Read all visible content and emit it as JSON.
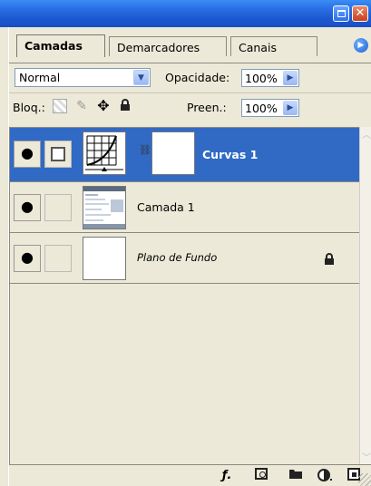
{
  "window": {
    "minimize_icon": "minimize-icon",
    "close_icon": "close-icon",
    "close_glyph": "✕"
  },
  "tabs": [
    {
      "label": "Camadas",
      "active": true
    },
    {
      "label": "Demarcadores",
      "active": false
    },
    {
      "label": "Canais",
      "active": false
    }
  ],
  "panel_menu_glyph": "▶",
  "blending": {
    "mode": "Normal",
    "opacity_label": "Opacidade:",
    "opacity_value": "100%"
  },
  "lock": {
    "label": "Bloq.:",
    "fill_label": "Preen.:",
    "fill_value": "100%"
  },
  "layers": [
    {
      "name": "Curvas 1",
      "selected": true,
      "has_mask": true
    },
    {
      "name": "Camada 1",
      "selected": false,
      "has_mask": false
    },
    {
      "name": "Plano de Fundo",
      "selected": false,
      "locked": true,
      "italic": true
    }
  ],
  "colors": {
    "selection": "#316ac5",
    "panel_bg": "#ece9d8",
    "titlebar": "#2b70e6"
  }
}
